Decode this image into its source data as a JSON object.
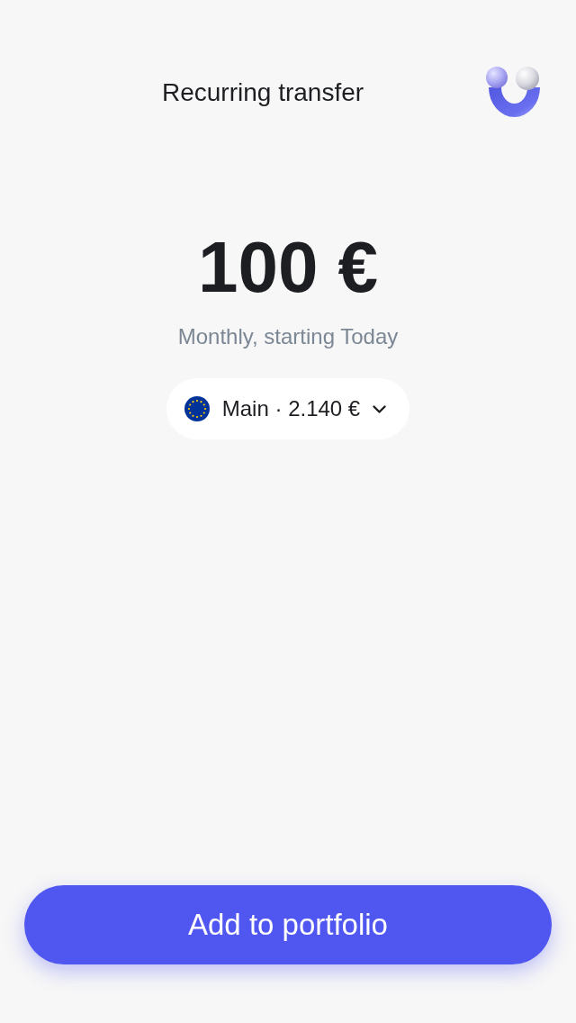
{
  "header": {
    "title": "Recurring transfer"
  },
  "amount": "100 €",
  "schedule": "Monthly, starting Today",
  "account_selector": {
    "label": "Main · 2.140 €"
  },
  "primary_button": {
    "label": "Add to portfolio"
  }
}
